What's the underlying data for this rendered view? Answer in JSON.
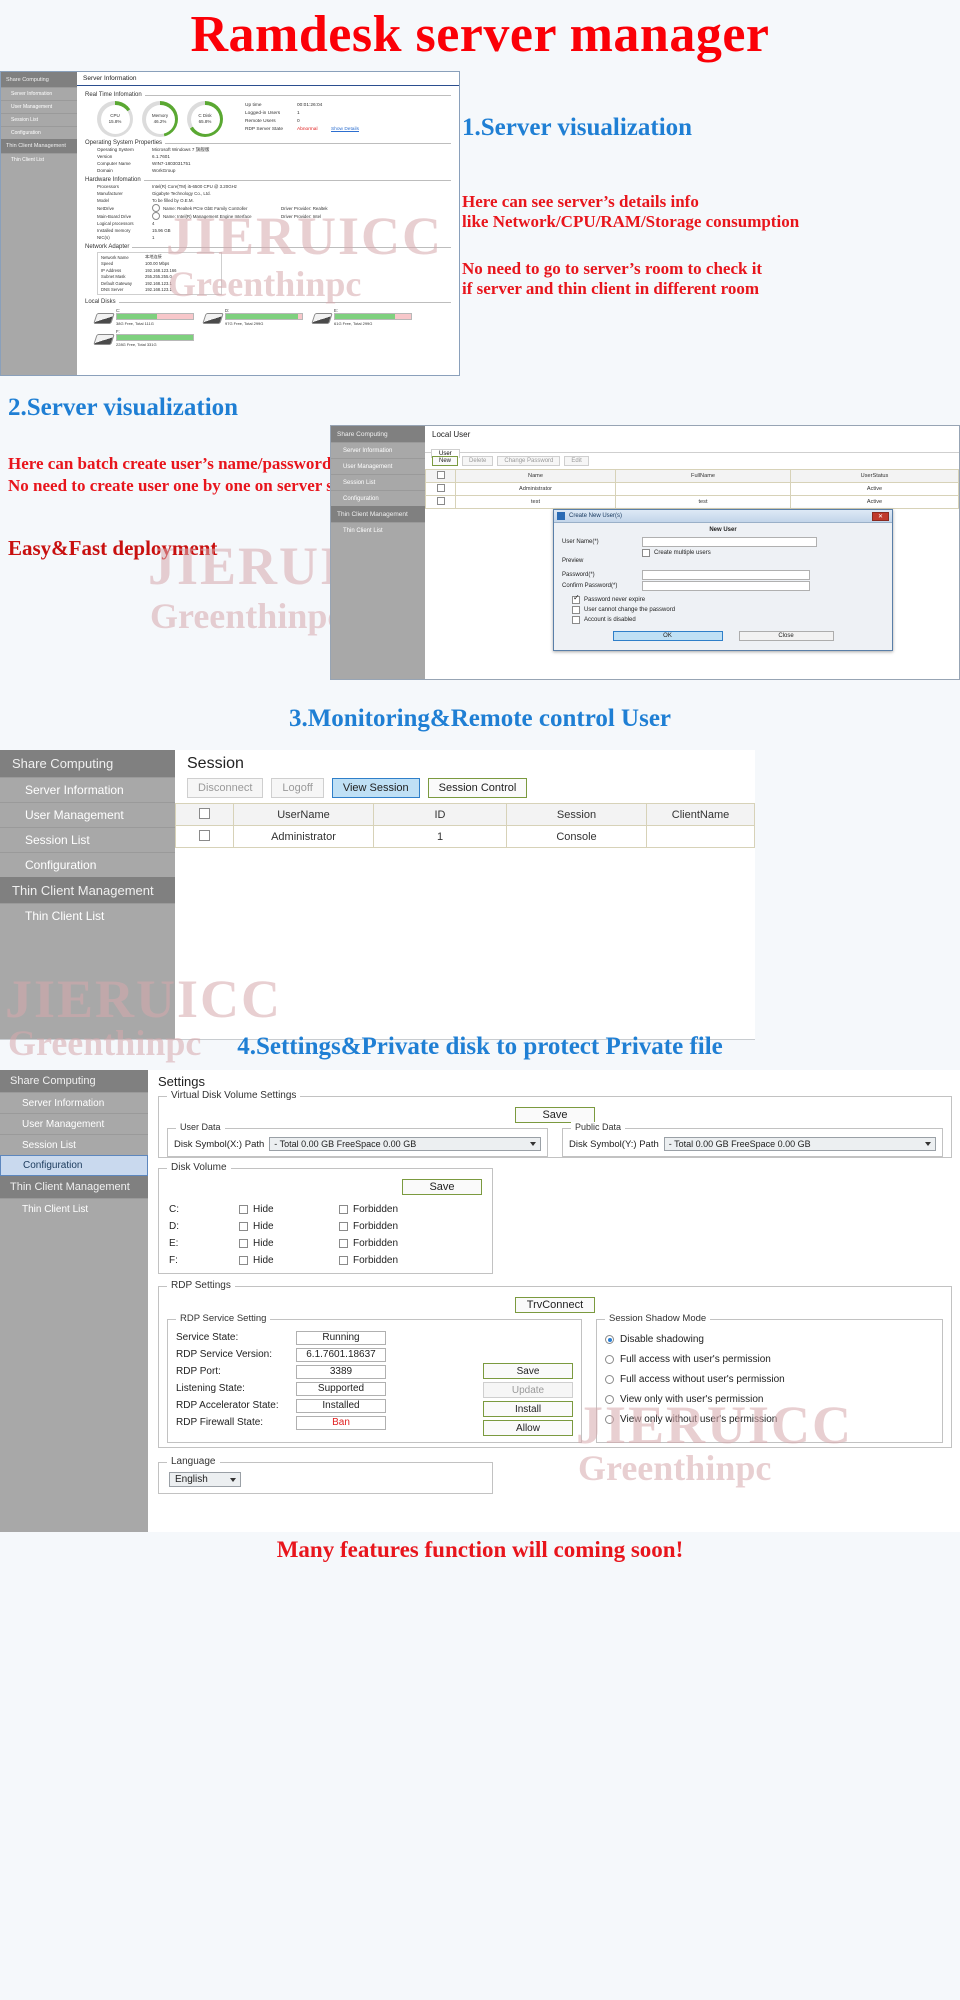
{
  "banner": {
    "title": "Ramdesk server manager"
  },
  "watermarks": {
    "line1": "JIERUICC",
    "line2": "Greenthinpc"
  },
  "sidebar": {
    "group1": "Share Computing",
    "items": [
      {
        "label": "Server Information"
      },
      {
        "label": "User Management"
      },
      {
        "label": "Session List"
      },
      {
        "label": "Configuration"
      }
    ],
    "group2": "Thin Client Management",
    "items2": [
      {
        "label": "Thin Client List"
      }
    ]
  },
  "section1": {
    "heading": "1.Server visualization",
    "note1_line1": "Here can see server’s details info",
    "note1_line2": "like Network/CPU/RAM/Storage consumption",
    "note2_line1": "No need to go to server’s room to check it",
    "note2_line2": "if server and thin client in different room",
    "panel": {
      "title": "Server Information",
      "realtime": {
        "legend": "Real Time Infomation",
        "gauges": [
          {
            "name": "CPU",
            "value": "15.8%",
            "pct": 16
          },
          {
            "name": "Memory",
            "value": "46.2%",
            "pct": 46
          },
          {
            "name": "C Disk",
            "value": "65.8%",
            "pct": 66
          }
        ],
        "stats": [
          {
            "label": "Up time",
            "value": "00:01:26:04"
          },
          {
            "label": "Logged-in Users",
            "value": "1"
          },
          {
            "label": "Remote Users",
            "value": "0"
          },
          {
            "label": "RDP Server State",
            "value": "Abnormal",
            "link": "Show Details"
          }
        ]
      },
      "os": {
        "legend": "Operating System Properties",
        "rows": [
          {
            "label": "Operating System",
            "value": "Microsoft Windows 7 旗舰版"
          },
          {
            "label": "Version",
            "value": "6.1.7601"
          },
          {
            "label": "Computer Name",
            "value": "WIN7-1803031751"
          },
          {
            "label": "Domain",
            "value": "WorkGroup"
          }
        ]
      },
      "hardware": {
        "legend": "Hardware Infomation",
        "rows": [
          {
            "label": "Processors",
            "value": "Intel(R) Core(TM) i5-6500 CPU @ 3.20GHz"
          },
          {
            "label": "Manufacturer",
            "value": "Gigabyte Technology Co., Ltd."
          },
          {
            "label": "Model",
            "value": "To be filled by O.E.M."
          },
          {
            "label": "NetDrive",
            "value": "Name: Realtek PCIe GbE Family Controller",
            "extra": "Driver Provider: Realtek",
            "dropdown": true
          },
          {
            "label": "Main-Board Drive",
            "value": "Name: Intel(R) Management Engine Interface",
            "extra": "Driver Provider: Intel",
            "dropdown": true
          },
          {
            "label": "Logical processors",
            "value": "4"
          },
          {
            "label": "Installed memory",
            "value": "15.96 GB"
          },
          {
            "label": "NIC(s)",
            "value": "1"
          }
        ]
      },
      "network": {
        "legend": "Network Adapter",
        "rows": [
          {
            "label": "Network Name",
            "value": "本地连接"
          },
          {
            "label": "Speed",
            "value": "100.00 Mbps"
          },
          {
            "label": "IP Address",
            "value": "192.168.123.166"
          },
          {
            "label": "Subnet Mask",
            "value": "255.255.255.0"
          },
          {
            "label": "Default Gateway",
            "value": "192.168.123.1"
          },
          {
            "label": "DNS Server",
            "value": "192.168.123.1"
          }
        ]
      },
      "disks": {
        "legend": "Local Disks",
        "items": [
          {
            "letter": "C:",
            "text": "38G Free,  Total 111G",
            "usedPct": 66
          },
          {
            "letter": "D:",
            "text": "97G Free,  Total 299G",
            "usedPct": 95
          },
          {
            "letter": "E:",
            "text": "61G Free,  Total 299G",
            "usedPct": 79
          },
          {
            "letter": "F:",
            "text": "228G Free,  Total 331G",
            "usedPct": 100
          }
        ]
      }
    }
  },
  "section2": {
    "heading": "2.Server visualization",
    "note1": "Here can batch create user’s name/password",
    "note2": "No need to create user one by one on server side",
    "note3": "Easy&Fast deployment",
    "panel": {
      "title": "Local User",
      "tab": "User",
      "toolbar": [
        {
          "label": "New",
          "state": "active"
        },
        {
          "label": "Delete",
          "state": "disabled"
        },
        {
          "label": "Change Password",
          "state": "disabled"
        },
        {
          "label": "Edit",
          "state": "disabled"
        }
      ],
      "table": {
        "headers": [
          "",
          "Name",
          "FullName",
          "UserStatus"
        ],
        "rows": [
          {
            "name": "Administrator",
            "fullname": "",
            "status": "Active"
          },
          {
            "name": "test",
            "fullname": "test",
            "status": "Active"
          }
        ]
      },
      "dialog": {
        "title": "Create New User(s)",
        "close": "✕",
        "section_label": "New User",
        "fields": [
          {
            "label": "User Name(*)",
            "value": ""
          },
          {
            "label": "Password(*)",
            "value": ""
          },
          {
            "label": "Confirm Password(*)",
            "value": ""
          }
        ],
        "preview_label": "Preview",
        "multi_checkbox": "Create multiple users",
        "checkboxes": [
          {
            "label": "Password never expire",
            "checked": true
          },
          {
            "label": "User cannot change the password",
            "checked": false
          },
          {
            "label": "Account is disabled",
            "checked": false
          }
        ],
        "ok": "OK",
        "cancel": "Close"
      }
    }
  },
  "section3": {
    "heading": "3.Monitoring&Remote control User",
    "panel": {
      "title": "Session",
      "toolbar": [
        {
          "label": "Disconnect",
          "state": "disabled"
        },
        {
          "label": "Logoff",
          "state": "disabled"
        },
        {
          "label": "View Session",
          "state": "selected"
        },
        {
          "label": "Session Control",
          "state": "active"
        }
      ],
      "table": {
        "headers": [
          "",
          "UserName",
          "ID",
          "Session",
          "ClientName"
        ],
        "rows": [
          {
            "username": "Administrator",
            "id": "1",
            "session": "Console",
            "client": ""
          }
        ]
      }
    }
  },
  "section4": {
    "heading": "4.Settings&Private disk to protect Private file",
    "panel": {
      "title": "Settings",
      "virtual_disk": {
        "legend": "Virtual Disk Volume Settings",
        "save": "Save",
        "user_data": {
          "legend": "User Data",
          "label": "Disk Symbol(X:) Path",
          "value": "-   Total  0.00 GB   FreeSpace 0.00 GB"
        },
        "public_data": {
          "legend": "Public Data",
          "label": "Disk Symbol(Y:) Path",
          "value": "-   Total  0.00 GB   FreeSpace 0.00 GB"
        }
      },
      "disk_volume": {
        "legend": "Disk Volume",
        "save": "Save",
        "col_hide": "Hide",
        "col_forbidden": "Forbidden",
        "rows": [
          {
            "drive": "C:",
            "hide": false,
            "forbidden": false
          },
          {
            "drive": "D:",
            "hide": false,
            "forbidden": false
          },
          {
            "drive": "E:",
            "hide": false,
            "forbidden": false
          },
          {
            "drive": "F:",
            "hide": false,
            "forbidden": false
          }
        ]
      },
      "rdp": {
        "legend": "RDP Settings",
        "trvconnect": "TrvConnect",
        "service": {
          "legend": "RDP Service Setting",
          "rows": [
            {
              "label": "Service State:",
              "value": "Running",
              "red": false
            },
            {
              "label": "RDP Service Version:",
              "value": "6.1.7601.18637",
              "red": false
            },
            {
              "label": "RDP Port:",
              "value": "3389",
              "red": false
            },
            {
              "label": "Listening State:",
              "value": "Supported",
              "red": false
            },
            {
              "label": "RDP Accelerator State:",
              "value": "Installed",
              "red": false
            },
            {
              "label": "RDP Firewall State:",
              "value": "Ban",
              "red": true
            }
          ],
          "buttons": [
            {
              "label": "Save",
              "state": "active"
            },
            {
              "label": "Update",
              "state": "disabled"
            },
            {
              "label": "Install",
              "state": "active"
            },
            {
              "label": "Allow",
              "state": "active"
            }
          ]
        },
        "shadow": {
          "legend": "Session Shadow Mode",
          "options": [
            {
              "label": "Disable shadowing",
              "checked": true
            },
            {
              "label": "Full access with user's permission",
              "checked": false
            },
            {
              "label": "Full access without user's permission",
              "checked": false
            },
            {
              "label": "View only with user's permission",
              "checked": false
            },
            {
              "label": "View only without user's permission",
              "checked": false
            }
          ]
        }
      },
      "language": {
        "legend": "Language",
        "value": "English"
      }
    }
  },
  "footer": {
    "text": "Many features function will coming soon!"
  }
}
